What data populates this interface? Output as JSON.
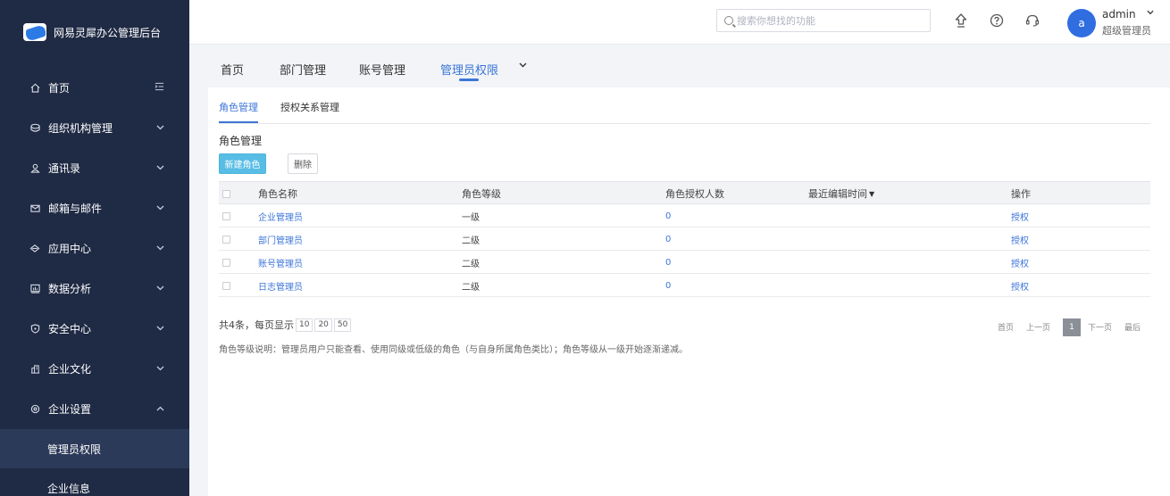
{
  "brand": {
    "title": "网易灵犀办公管理后台"
  },
  "sidebar": {
    "items": [
      {
        "label": "首页",
        "icon": "home-icon",
        "arrow": "collapse"
      },
      {
        "label": "组织机构管理",
        "icon": "org-icon",
        "arrow": "down"
      },
      {
        "label": "通讯录",
        "icon": "contacts-icon",
        "arrow": "down"
      },
      {
        "label": "邮箱与邮件",
        "icon": "mail-icon",
        "arrow": "down"
      },
      {
        "label": "应用中心",
        "icon": "app-icon",
        "arrow": "down"
      },
      {
        "label": "数据分析",
        "icon": "chart-icon",
        "arrow": "down"
      },
      {
        "label": "安全中心",
        "icon": "shield-icon",
        "arrow": "down"
      },
      {
        "label": "企业文化",
        "icon": "culture-icon",
        "arrow": "down"
      },
      {
        "label": "企业设置",
        "icon": "settings-icon",
        "arrow": "up"
      }
    ],
    "subitems": [
      {
        "label": "管理员权限",
        "active": true
      },
      {
        "label": "企业信息",
        "active": false
      }
    ]
  },
  "topbar": {
    "search_placeholder": "搜索你想找的功能",
    "avatar_letter": "a",
    "user_name": "admin",
    "user_role": "超级管理员"
  },
  "pagetabs": [
    "首页",
    "部门管理",
    "账号管理",
    "管理员权限"
  ],
  "subtabs": [
    "角色管理",
    "授权关系管理"
  ],
  "section": {
    "title": "角色管理",
    "new_button": "新建角色",
    "delete_button": "删除"
  },
  "table": {
    "headers": [
      "角色名称",
      "角色等级",
      "角色授权人数",
      "最近编辑时间",
      "操作"
    ],
    "rows": [
      {
        "name": "企业管理员",
        "level": "一级",
        "count": "0",
        "time": "",
        "action": "授权"
      },
      {
        "name": "部门管理员",
        "level": "二级",
        "count": "0",
        "time": "",
        "action": "授权"
      },
      {
        "name": "账号管理员",
        "level": "二级",
        "count": "0",
        "time": "",
        "action": "授权"
      },
      {
        "name": "日志管理员",
        "level": "二级",
        "count": "0",
        "time": "",
        "action": "授权"
      }
    ]
  },
  "footer": {
    "count_text": "共4条，每页显示",
    "page_sizes": [
      "10",
      "20",
      "50"
    ],
    "pager": {
      "first": "首页",
      "prev": "上一页",
      "current": "1",
      "next": "下一页",
      "last": "最后"
    },
    "note": "角色等级说明：管理员用户只能查看、使用同级或低级的角色（与自身所属角色类比）；角色等级从一级开始逐渐递减。"
  },
  "colors": {
    "sidebar_bg": "#1f2a44",
    "accent": "#3d76d8",
    "primary_button": "#58bde5"
  }
}
